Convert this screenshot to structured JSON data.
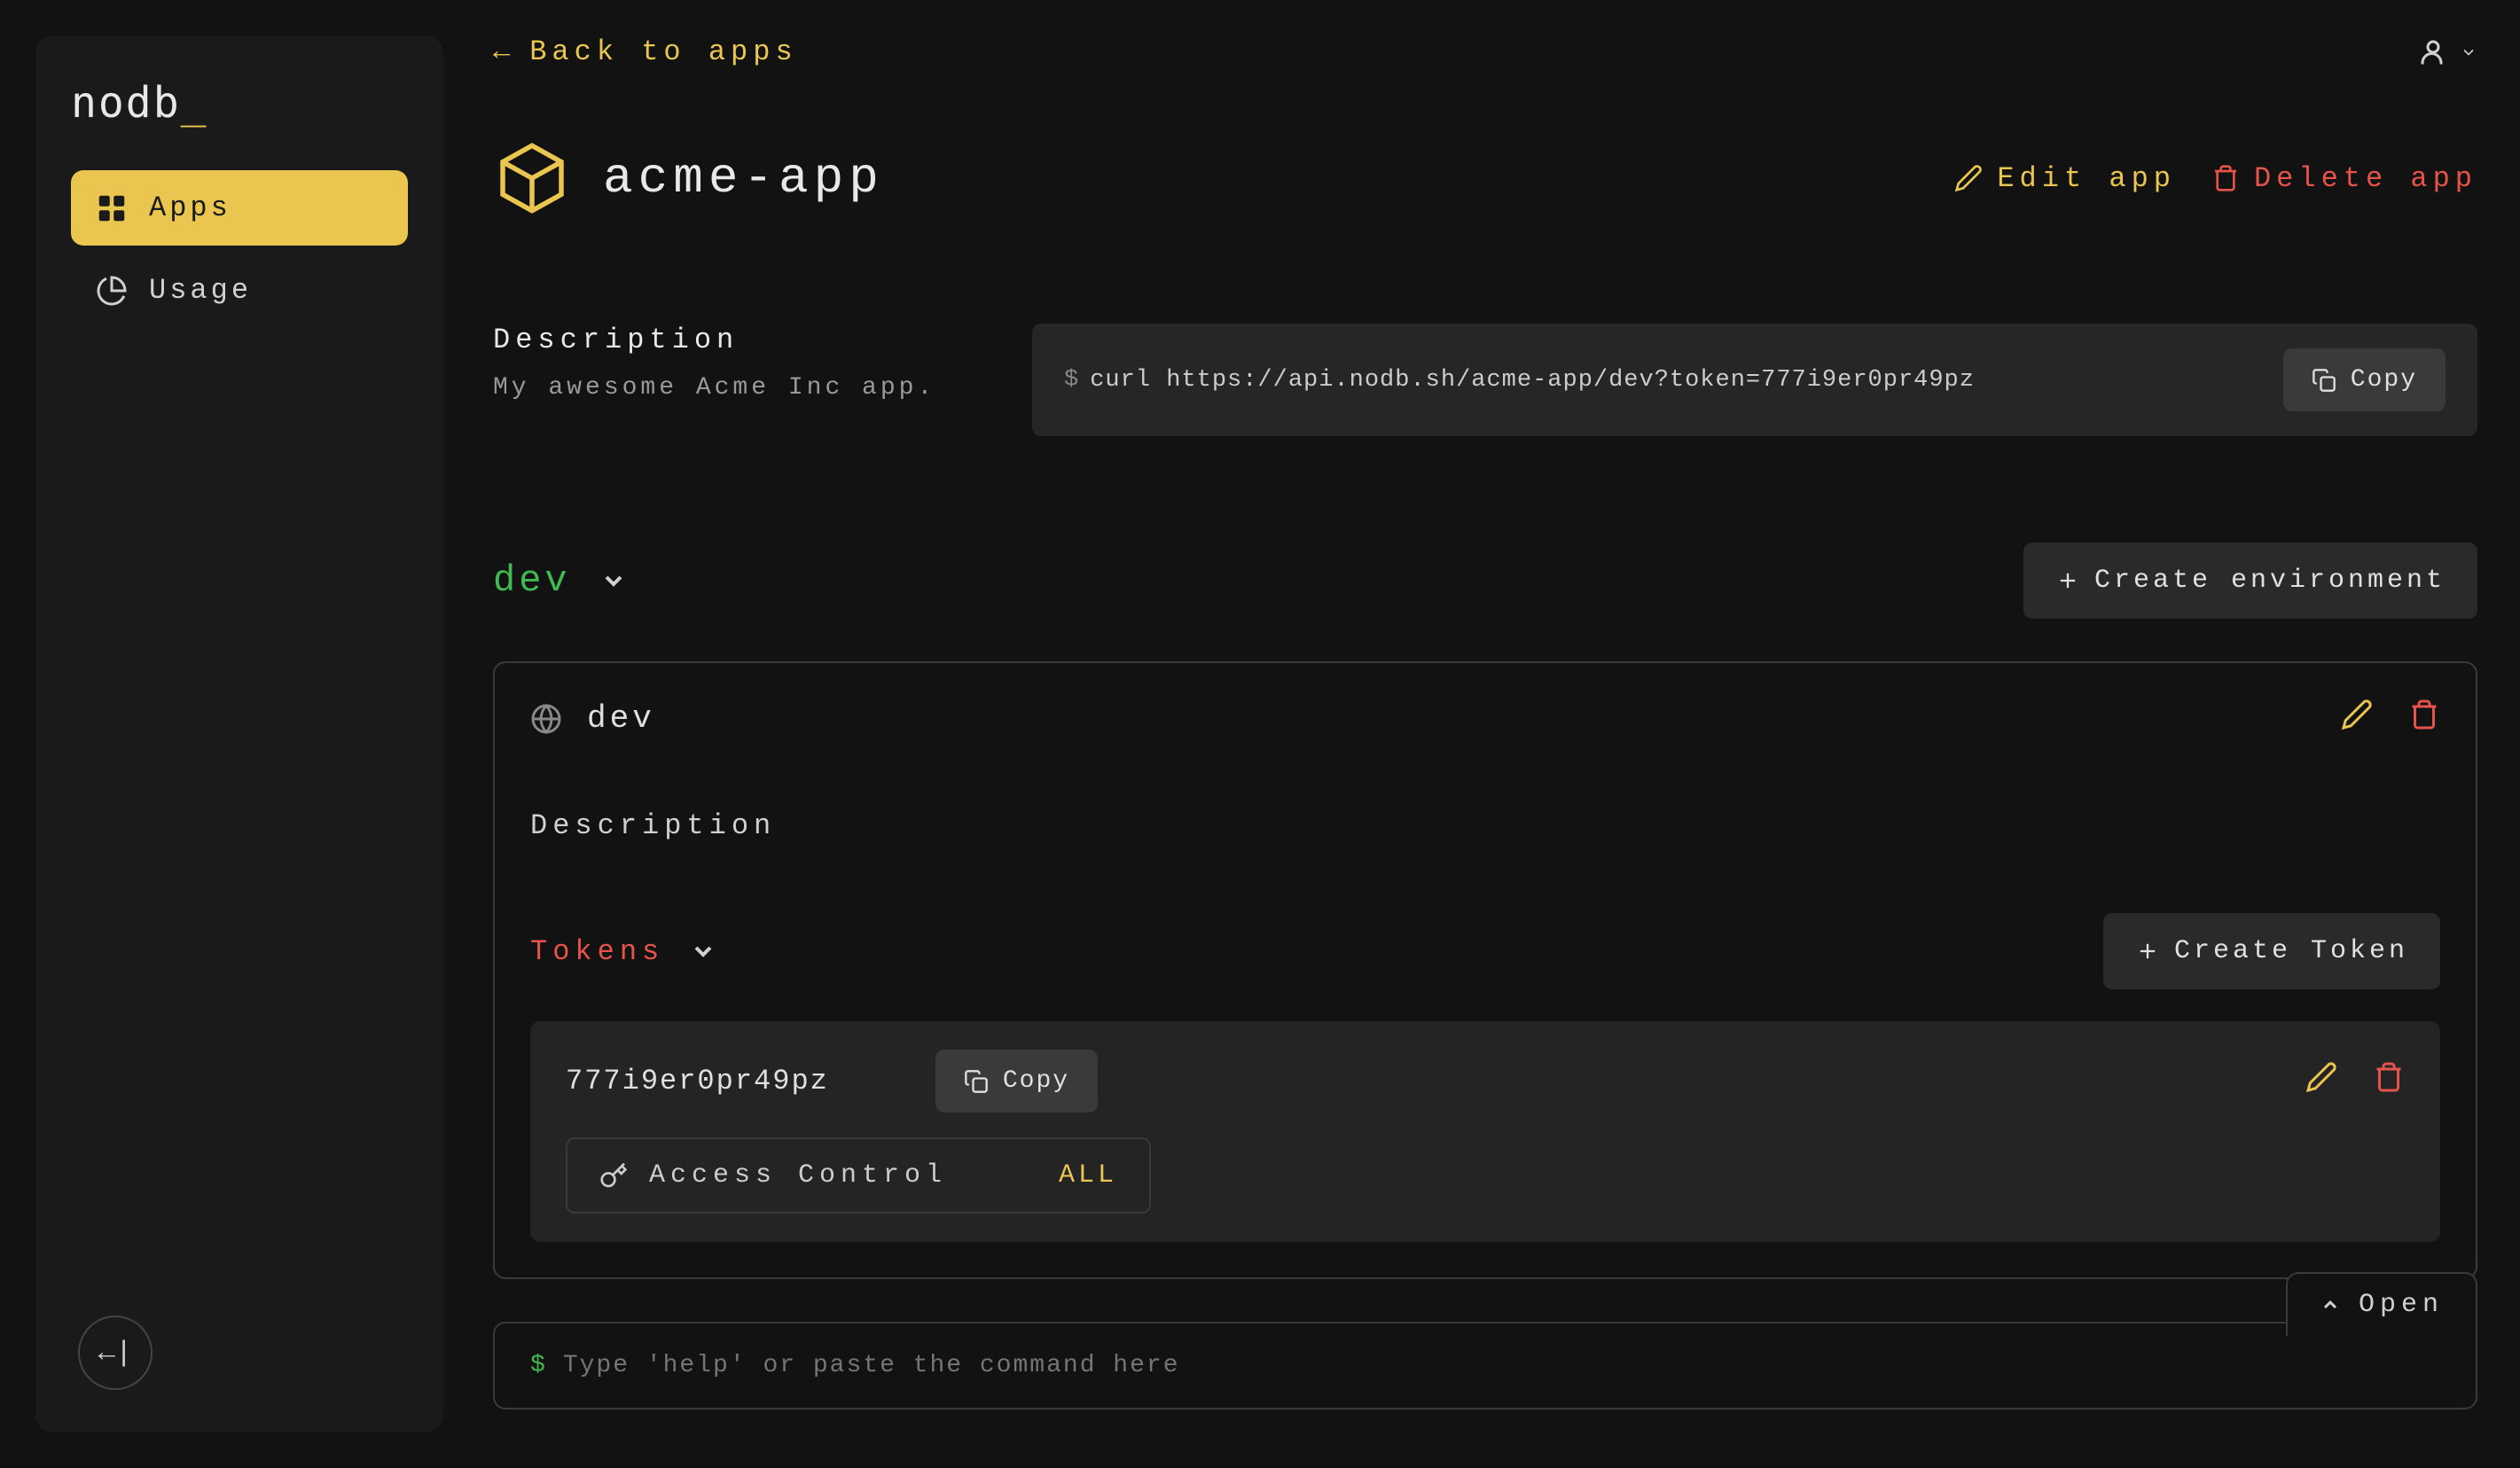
{
  "logo": {
    "text": "nodb",
    "cursor": "_"
  },
  "sidebar": {
    "items": [
      {
        "label": "Apps",
        "active": true
      },
      {
        "label": "Usage",
        "active": false
      }
    ]
  },
  "header": {
    "back": "Back to apps",
    "app_name": "acme-app",
    "edit_label": "Edit app",
    "delete_label": "Delete app"
  },
  "description": {
    "label": "Description",
    "text": "My awesome Acme Inc app."
  },
  "curl": {
    "command": "curl https://api.nodb.sh/acme-app/dev?token=777i9er0pr49pz",
    "copy_label": "Copy"
  },
  "env_selector": {
    "current": "dev",
    "create_label": "Create environment"
  },
  "env_card": {
    "name": "dev",
    "desc_label": "Description",
    "tokens_label": "Tokens",
    "create_token_label": "Create Token",
    "token": {
      "value": "777i9er0pr49pz",
      "copy_label": "Copy",
      "access_label": "Access Control",
      "access_value": "ALL"
    }
  },
  "terminal": {
    "open_label": "Open",
    "placeholder": "Type 'help' or paste the command here"
  }
}
